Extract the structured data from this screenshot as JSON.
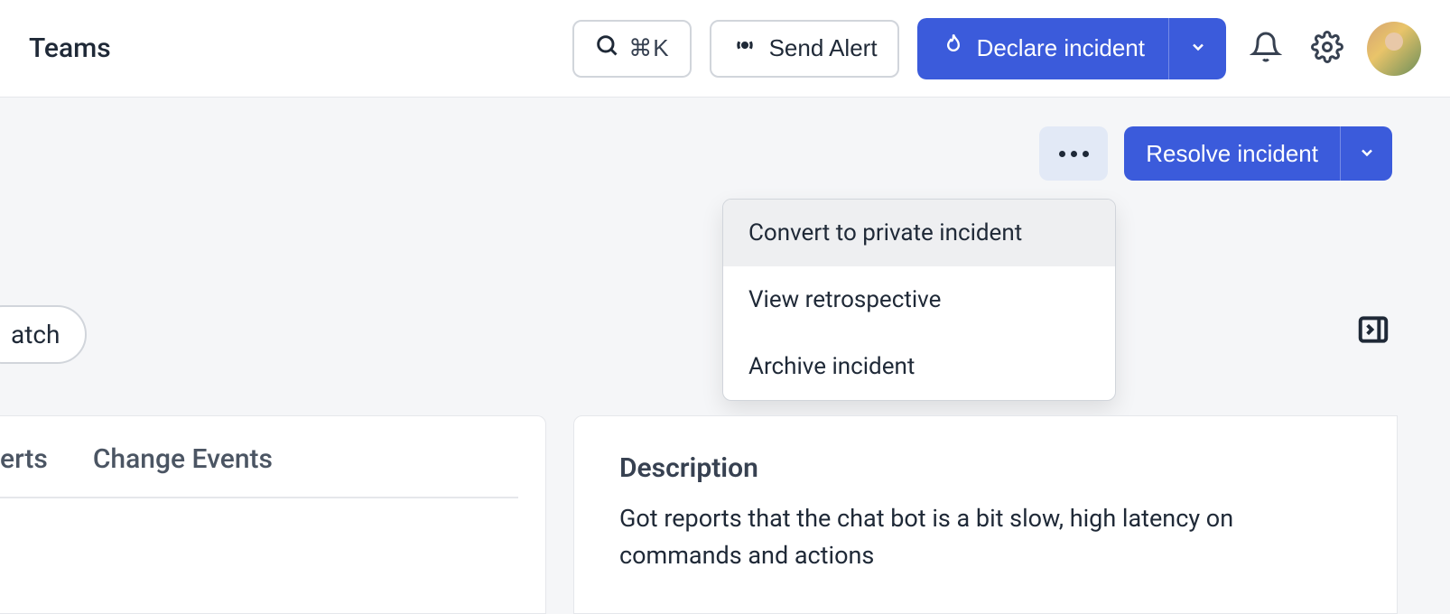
{
  "topbar": {
    "title": "Teams",
    "search_shortcut": "⌘K",
    "send_alert_label": "Send Alert",
    "declare_incident_label": "Declare incident"
  },
  "actions": {
    "resolve_label": "Resolve incident"
  },
  "dropdown": {
    "items": [
      "Convert to private incident",
      "View retrospective",
      "Archive incident"
    ]
  },
  "pill_label": "atch",
  "tabs": {
    "first": "erts",
    "second": "Change Events"
  },
  "description": {
    "title": "Description",
    "text": "Got reports that the chat bot is a bit slow, high latency on commands and actions"
  }
}
